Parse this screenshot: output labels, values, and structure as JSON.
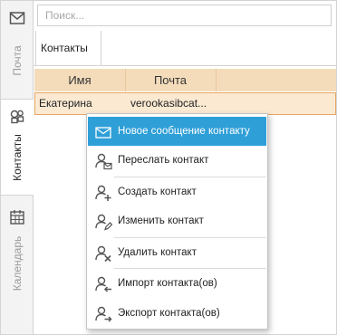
{
  "sidebar": {
    "tabs": [
      {
        "label": "Почта",
        "icon": "mail-icon"
      },
      {
        "label": "Контакты",
        "icon": "contacts-icon"
      },
      {
        "label": "Календарь",
        "icon": "calendar-icon"
      }
    ]
  },
  "search": {
    "placeholder": "Поиск...",
    "value": ""
  },
  "main": {
    "tab_label": "Контакты",
    "columns": [
      "Имя",
      "Почта"
    ],
    "rows": [
      [
        "Екатерина",
        "verookasibcat..."
      ]
    ]
  },
  "context_menu": {
    "items": [
      {
        "label": "Новое сообщение контакту",
        "icon": "mail-icon"
      },
      {
        "label": "Переслать контакт",
        "icon": "forward-contact-icon"
      },
      {
        "label": "Создать контакт",
        "icon": "add-contact-icon"
      },
      {
        "label": "Изменить контакт",
        "icon": "edit-contact-icon"
      },
      {
        "label": "Удалить контакт",
        "icon": "delete-contact-icon"
      },
      {
        "label": "Импорт контакта(ов)",
        "icon": "import-contact-icon"
      },
      {
        "label": "Экспорт контакта(ов)",
        "icon": "export-contact-icon"
      }
    ]
  },
  "colors": {
    "accent": "#2f9fd8",
    "header": "#f4dcbb",
    "selected_row": "#fbe9d2"
  }
}
